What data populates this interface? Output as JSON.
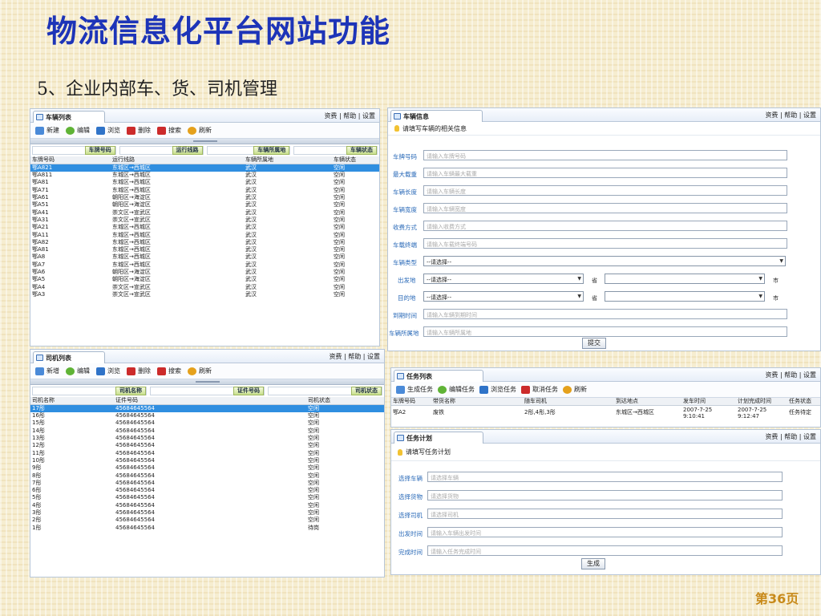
{
  "slide": {
    "title": "物流信息化平台网站功能",
    "subtitle": "5、企业内部车、货、司机管理",
    "page": "第36页"
  },
  "links": "资费 | 帮助 | 设置",
  "vehicle_list": {
    "tab": "车辆列表",
    "toolbar": [
      "新建",
      "编辑",
      "浏览",
      "删除",
      "搜索",
      "刷新"
    ],
    "filters": [
      "车牌号码",
      "运行线路",
      "车辆所属地",
      "车辆状态"
    ],
    "columns": [
      "车牌号码",
      "运行线路",
      "车辆所属地",
      "车辆状态"
    ],
    "rows": [
      [
        "鄂A821",
        "东城区→西城区",
        "武汉",
        "空闲"
      ],
      [
        "鄂A811",
        "东城区→西城区",
        "武汉",
        "空闲"
      ],
      [
        "鄂A81",
        "东城区→西城区",
        "武汉",
        "空闲"
      ],
      [
        "鄂A71",
        "东城区→西城区",
        "武汉",
        "空闲"
      ],
      [
        "鄂A61",
        "朝阳区→海淀区",
        "武汉",
        "空闲"
      ],
      [
        "鄂A51",
        "朝阳区→海淀区",
        "武汉",
        "空闲"
      ],
      [
        "鄂A41",
        "崇文区→宣武区",
        "武汉",
        "空闲"
      ],
      [
        "鄂A31",
        "崇文区→宣武区",
        "武汉",
        "空闲"
      ],
      [
        "鄂A21",
        "东城区→西城区",
        "武汉",
        "空闲"
      ],
      [
        "鄂A11",
        "东城区→西城区",
        "武汉",
        "空闲"
      ],
      [
        "鄂A82",
        "东城区→西城区",
        "武汉",
        "空闲"
      ],
      [
        "鄂A81",
        "东城区→西城区",
        "武汉",
        "空闲"
      ],
      [
        "鄂A8",
        "东城区→西城区",
        "武汉",
        "空闲"
      ],
      [
        "鄂A7",
        "东城区→西城区",
        "武汉",
        "空闲"
      ],
      [
        "鄂A6",
        "朝阳区→海淀区",
        "武汉",
        "空闲"
      ],
      [
        "鄂A5",
        "朝阳区→海淀区",
        "武汉",
        "空闲"
      ],
      [
        "鄂A4",
        "崇文区→宣武区",
        "武汉",
        "空闲"
      ],
      [
        "鄂A3",
        "崇文区→宣武区",
        "武汉",
        "空闲"
      ]
    ]
  },
  "driver_list": {
    "tab": "司机列表",
    "toolbar": [
      "新增",
      "编辑",
      "浏览",
      "删除",
      "搜索",
      "刷新"
    ],
    "filters": [
      "司机名称",
      "证件号码",
      "司机状态"
    ],
    "columns": [
      "司机名称",
      "证件号码",
      "司机状态"
    ],
    "rows": [
      [
        "17彤",
        "45684645564",
        "空闲"
      ],
      [
        "16彤",
        "45684645564",
        "空闲"
      ],
      [
        "15彤",
        "45684645564",
        "空闲"
      ],
      [
        "14彤",
        "45684645564",
        "空闲"
      ],
      [
        "13彤",
        "45684645564",
        "空闲"
      ],
      [
        "12彤",
        "45684645564",
        "空闲"
      ],
      [
        "11彤",
        "45684645564",
        "空闲"
      ],
      [
        "10彤",
        "45684645564",
        "空闲"
      ],
      [
        "9彤",
        "45684645564",
        "空闲"
      ],
      [
        "8彤",
        "45684645564",
        "空闲"
      ],
      [
        "7彤",
        "45684645564",
        "空闲"
      ],
      [
        "6彤",
        "45684645564",
        "空闲"
      ],
      [
        "5彤",
        "45684645564",
        "空闲"
      ],
      [
        "4彤",
        "45684645564",
        "空闲"
      ],
      [
        "3彤",
        "45684645564",
        "空闲"
      ],
      [
        "2彤",
        "45684645564",
        "空闲"
      ],
      [
        "1彤",
        "45684645564",
        "待岗"
      ]
    ]
  },
  "vehicle_info": {
    "tab": "车辆信息",
    "hint": "请填写车辆的相关信息",
    "fields": [
      {
        "label": "车牌号码",
        "placeholder": "请输入车牌号码"
      },
      {
        "label": "最大载重",
        "placeholder": "请输入车辆最大载重"
      },
      {
        "label": "车辆长度",
        "placeholder": "请输入车辆长度"
      },
      {
        "label": "车辆宽度",
        "placeholder": "请输入车辆宽度"
      },
      {
        "label": "收费方式",
        "placeholder": "请输入收费方式"
      },
      {
        "label": "车载终端",
        "placeholder": "请输入车载终端号码"
      }
    ],
    "type_label": "车辆类型",
    "select_default": "--请选择--",
    "from_label": "出发地",
    "to_label": "目的地",
    "province": "省",
    "city": "市",
    "arrive_label": "到期时间",
    "arrive_ph": "请输入车辆到期时间",
    "owner_label": "车辆所属地",
    "owner_ph": "请输入车辆所属地",
    "submit": "提交"
  },
  "task_list": {
    "tab": "任务列表",
    "toolbar": [
      "生成任务",
      "编辑任务",
      "浏览任务",
      "取消任务",
      "刷新"
    ],
    "columns": [
      "车牌号码",
      "带货名称",
      "随车司机",
      "到达地点",
      "发车时间",
      "计划完成时间",
      "任务状态"
    ],
    "rows": [
      [
        "鄂A2",
        "废铁",
        "2彤,4彤,3彤",
        "东城区→西城区",
        "2007-7-25 9:10:41",
        "2007-7-25 9:12:47",
        "任务待定"
      ]
    ]
  },
  "task_plan": {
    "tab": "任务计划",
    "hint": "请填写任务计划",
    "fields": [
      {
        "label": "选择车辆",
        "placeholder": "请选择车辆"
      },
      {
        "label": "选择货物",
        "placeholder": "请选择货物"
      },
      {
        "label": "选择司机",
        "placeholder": "请选择司机"
      },
      {
        "label": "出发时间",
        "placeholder": "请输入车辆出发时间"
      },
      {
        "label": "完成时间",
        "placeholder": "请输入任务完成时间"
      }
    ],
    "submit": "生成"
  }
}
